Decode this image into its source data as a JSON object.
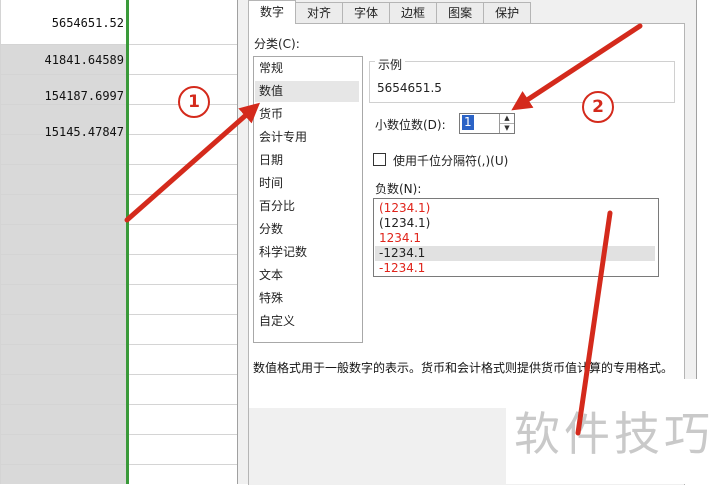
{
  "sheet": {
    "cells": [
      "5654651.52",
      "41841.64589",
      "154187.6997",
      "15145.47847"
    ]
  },
  "dialog": {
    "tabs": [
      {
        "label": "数字",
        "active": true
      },
      {
        "label": "对齐"
      },
      {
        "label": "字体"
      },
      {
        "label": "边框"
      },
      {
        "label": "图案"
      },
      {
        "label": "保护"
      }
    ],
    "category_label": "分类(C):",
    "categories": [
      {
        "label": "常规"
      },
      {
        "label": "数值",
        "selected": true
      },
      {
        "label": "货币"
      },
      {
        "label": "会计专用"
      },
      {
        "label": "日期"
      },
      {
        "label": "时间"
      },
      {
        "label": "百分比"
      },
      {
        "label": "分数"
      },
      {
        "label": "科学记数"
      },
      {
        "label": "文本"
      },
      {
        "label": "特殊"
      },
      {
        "label": "自定义"
      }
    ],
    "sample_label": "示例",
    "sample_value": "5654651.5",
    "decimal_label": "小数位数(D):",
    "decimal_value": "1",
    "thousands_label": "使用千位分隔符(,)(U)",
    "thousands_checked": false,
    "negative_label": "负数(N):",
    "negative_options": [
      {
        "label": "(1234.1)",
        "color": "red"
      },
      {
        "label": "(1234.1)",
        "color": "black"
      },
      {
        "label": "1234.1",
        "color": "red"
      },
      {
        "label": "-1234.1",
        "color": "black",
        "selected": true
      },
      {
        "label": "-1234.1",
        "color": "red"
      }
    ],
    "description": "数值格式用于一般数字的表示。货币和会计格式则提供货币值计算的专用格式。"
  },
  "annotations": {
    "badges": [
      "1",
      "2"
    ],
    "color": "#d42a1c"
  },
  "watermark": "软件技巧",
  "colors": {
    "selection_green": "#3a9a3a",
    "selected_column": "#d9d9d9",
    "negative_red": "#e0241b",
    "spin_highlight": "#2b63c6"
  }
}
